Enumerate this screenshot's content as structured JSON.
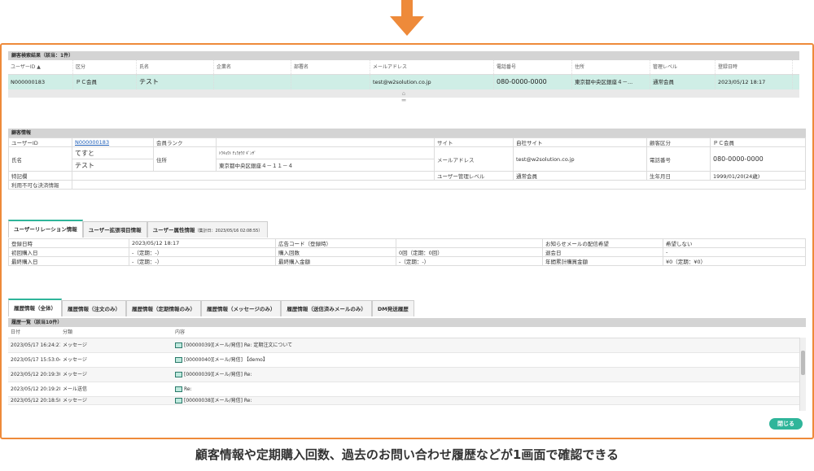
{
  "search": {
    "title": "顧客検索結果（該当：1件）",
    "columns": [
      "ユーザーID",
      "区分",
      "氏名",
      "企業名",
      "部署名",
      "メールアドレス",
      "電話番号",
      "住所",
      "管理レベル",
      "登録日時"
    ],
    "row": [
      "N000000183",
      "ＰＣ会員",
      "テスト",
      "",
      "",
      "test@w2solution.co.jp",
      "080-0000-0000",
      "東京都中央区銀座４－...",
      "通常会員",
      "2023/05/12 18:17"
    ]
  },
  "customer": {
    "title": "顧客情報",
    "user_id_label": "ユーザーID",
    "user_id": "N000000183",
    "rank_label": "会員ランク",
    "rank": "",
    "site_label": "サイト",
    "site": "自社サイト",
    "class_label": "顧客区分",
    "class": "ＰＣ会員",
    "name_label": "氏名",
    "name_kana": "てすと",
    "name": "テスト",
    "address_label": "住所",
    "address_kana": "ﾄｳｷｮｳﾄ ﾁｭｳｵｳｸ ｷﾞﾝｻﾞ",
    "address": "東京都中央区銀座４－１１－４",
    "mail_label": "メールアドレス",
    "mail": "test@w2solution.co.jp",
    "tel_label": "電話番号",
    "tel": "080-0000-0000",
    "note_label": "特記欄",
    "level_label": "ユーザー管理レベル",
    "level": "通常会員",
    "birth_label": "生年月日",
    "birth": "1999/01/20(24歳)",
    "payment_label": "利用不可な決済情報"
  },
  "relation_tabs": {
    "tab1": "ユーザーリレーション情報",
    "tab2": "ユーザー拡張項目情報",
    "tab3": "ユーザー属性情報",
    "tab3_sub": "（集計日：2023/05/16 02:08:55）"
  },
  "relation": {
    "r1": [
      "登録日時",
      "2023/05/12 18:17",
      "広告コード（登録時）",
      "",
      "お知らせメールの配信希望",
      "希望しない"
    ],
    "r2": [
      "初回購入日",
      "-（定期：-）",
      "購入回数",
      "0回（定期：0回）",
      "退会日",
      "-"
    ],
    "r3": [
      "最終購入日",
      "-（定期：-）",
      "最終購入金額",
      "-（定期：-）",
      "年間累計購買金額",
      "¥0（定期：¥0）"
    ]
  },
  "history_tabs": {
    "t1": "履歴情報（全体）",
    "t2": "履歴情報（注文のみ）",
    "t3": "履歴情報（定期情報のみ）",
    "t4": "履歴情報（メッセージのみ）",
    "t5": "履歴情報（送信済みメールのみ）",
    "t6": "DM発送履歴"
  },
  "history": {
    "title": "履歴一覧（該当10件）",
    "columns": [
      "日付",
      "分類",
      "内容"
    ],
    "rows": [
      [
        "2023/05/17 16:24:21",
        "メッセージ",
        "[00000039][メール/発信] Re: 定期注文について"
      ],
      [
        "2023/05/17 15:53:04",
        "メッセージ",
        "[00000040][メール/発信] 【demo】"
      ],
      [
        "2023/05/12 20:19:30",
        "メッセージ",
        "[00000039][メール/発信] Re:"
      ],
      [
        "2023/05/12 20:19:28",
        "メール送信",
        "Re:"
      ],
      [
        "2023/05/12 20:18:50",
        "メッセージ",
        "[00000038][メール/発信] Re:"
      ]
    ]
  },
  "close_label": "閉じる",
  "caption": "顧客情報や定期購入回数、過去のお問い合わせ履歴などが1画面で確認できる",
  "colors": {
    "accent": "#2fb59a",
    "frame": "#ee8a3a",
    "selected_row": "#cfeee6"
  }
}
